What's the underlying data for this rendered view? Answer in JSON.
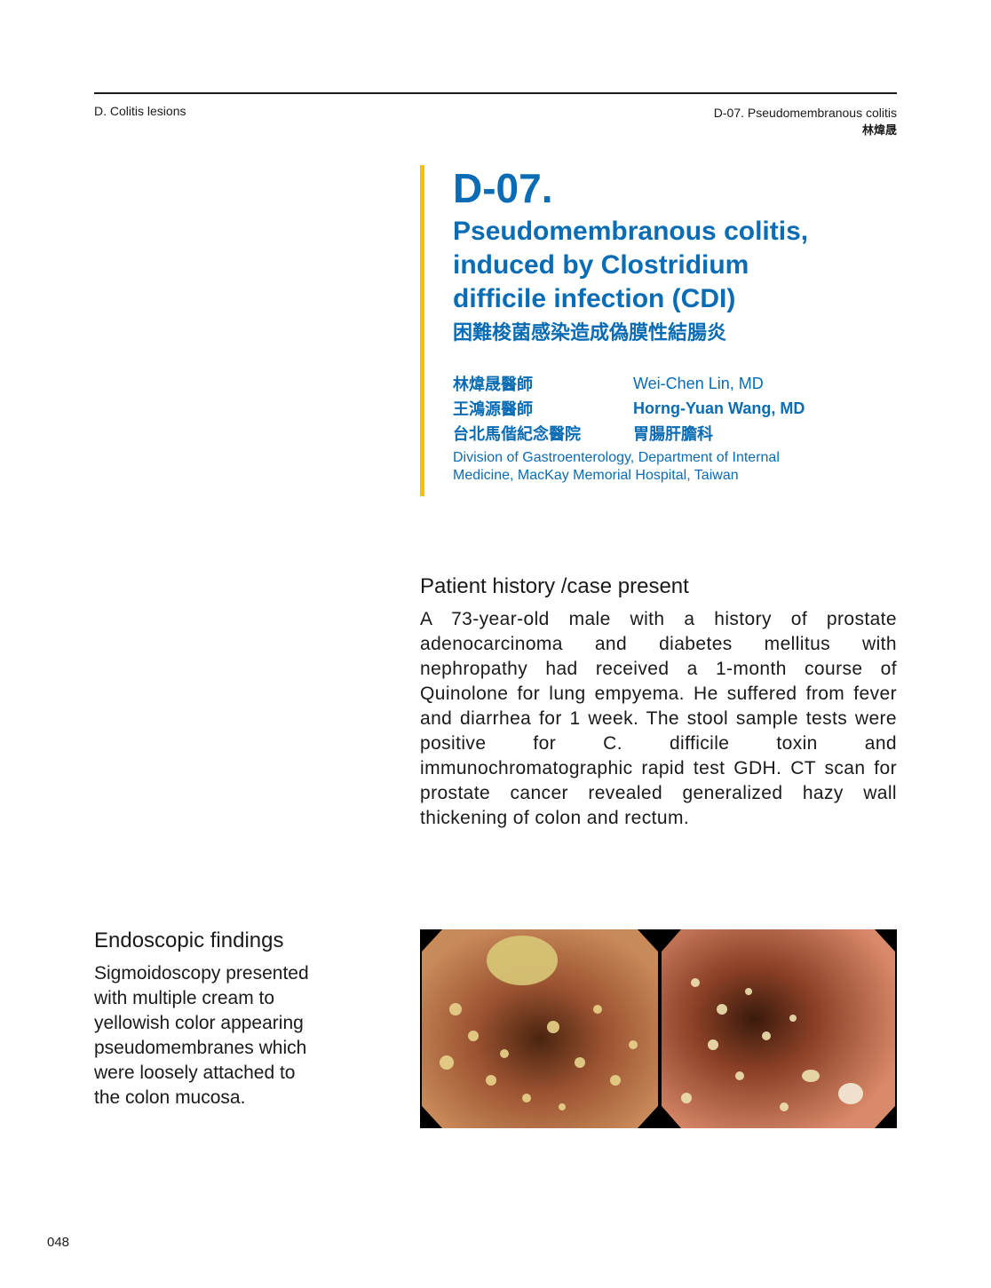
{
  "header": {
    "left": "D. Colitis lesions",
    "right": "D-07. Pseudomembranous colitis",
    "right_cn": "林煒晟"
  },
  "title": {
    "code": "D-07.",
    "english_lines": [
      "Pseudomembranous colitis,",
      "induced by Clostridium",
      "difficile infection (CDI)"
    ],
    "chinese": "困難梭菌感染造成偽膜性結腸炎"
  },
  "authors": [
    {
      "cn": "林煒晟醫師",
      "en": "Wei-Chen Lin, MD"
    },
    {
      "cn": "王鴻源醫師",
      "en": "Horng-Yuan Wang, MD"
    },
    {
      "cn": "台北馬偕紀念醫院",
      "en": "胃腸肝膽科"
    }
  ],
  "affiliation_lines": [
    "Division of Gastroenterology, Department of Internal",
    "Medicine, MacKay Memorial Hospital, Taiwan"
  ],
  "history": {
    "title": "Patient history /case present",
    "body": "A 73-year-old male with a history of prostate adenocarcinoma and diabetes mellitus with nephropathy had received a 1-month course of Quinolone for lung empyema. He suffered from fever and diarrhea for 1 week. The stool sample tests were positive for C. difficile toxin and immunochromatographic rapid test GDH. CT scan for prostate cancer revealed generalized hazy wall thickening of colon and rectum."
  },
  "endoscopic": {
    "title": "Endoscopic findings",
    "lines": [
      "Sigmoidoscopy presented",
      "with multiple cream to",
      "yellowish color appearing",
      "pseudomembranes which",
      "were loosely attached to",
      "the colon mucosa."
    ]
  },
  "page_number": "048"
}
